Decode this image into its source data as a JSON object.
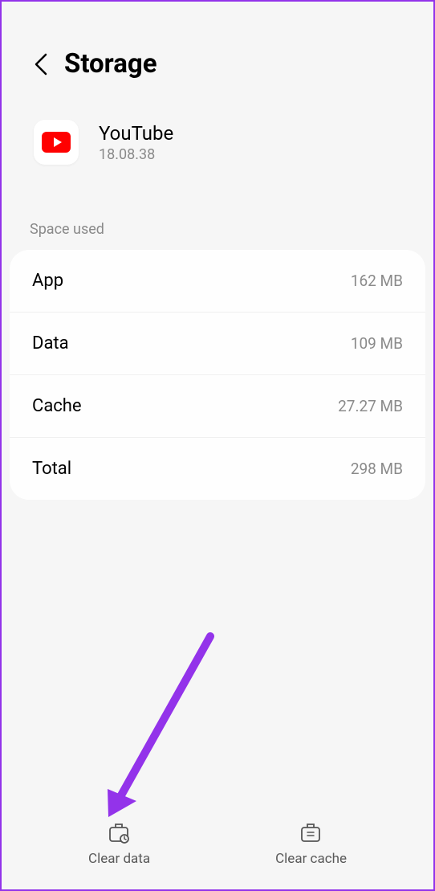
{
  "header": {
    "title": "Storage"
  },
  "app": {
    "name": "YouTube",
    "version": "18.08.38"
  },
  "section_label": "Space used",
  "storage": {
    "rows": [
      {
        "label": "App",
        "value": "162 MB"
      },
      {
        "label": "Data",
        "value": "109 MB"
      },
      {
        "label": "Cache",
        "value": "27.27 MB"
      },
      {
        "label": "Total",
        "value": "298 MB"
      }
    ]
  },
  "actions": {
    "clear_data": "Clear data",
    "clear_cache": "Clear cache"
  }
}
